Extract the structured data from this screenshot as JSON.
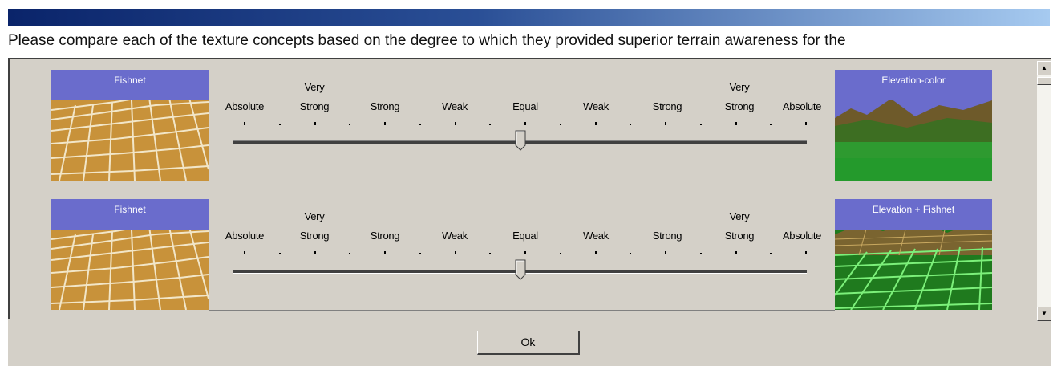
{
  "question": "Please compare each of the texture concepts based on the degree to which they provided superior terrain awareness for the",
  "scale": {
    "top_labels": [
      "Very",
      "Very"
    ],
    "labels": [
      "Absolute",
      "Strong",
      "Strong",
      "Weak",
      "Equal",
      "Weak",
      "Strong",
      "Strong",
      "Absolute"
    ]
  },
  "comparisons": [
    {
      "left": "Fishnet",
      "right": "Elevation-color",
      "slider_value": "Equal"
    },
    {
      "left": "Fishnet",
      "right": "Elevation + Fishnet",
      "slider_value": "Equal"
    }
  ],
  "ok_label": "Ok",
  "colors": {
    "titlebar_start": "#0a246a",
    "titlebar_end": "#a6caf0",
    "image_label_bg": "#6a6ccc",
    "dialog_bg": "#d4d0c8"
  }
}
